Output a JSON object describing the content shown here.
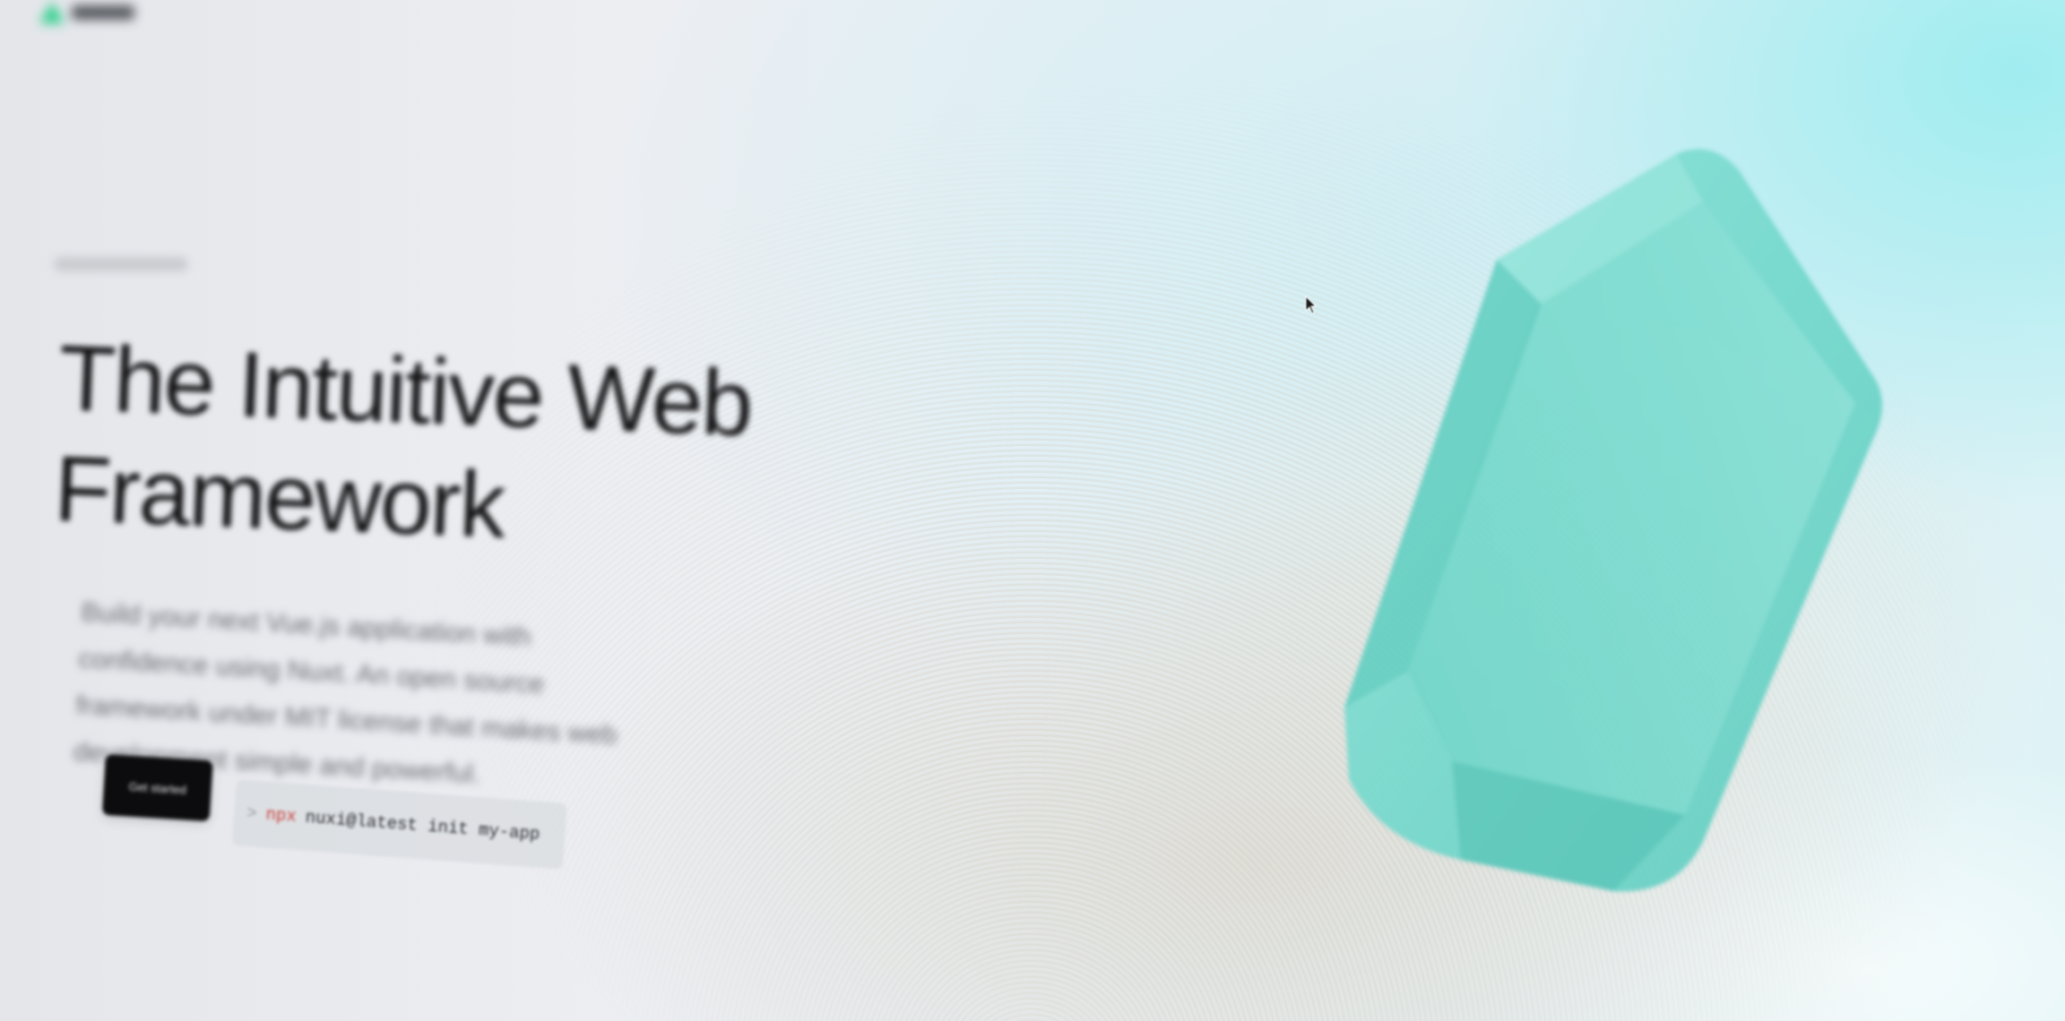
{
  "hero": {
    "headline": "The Intuitive Web\nFramework",
    "description": "Build your next Vue.js application with confidence using Nuxt. An open source framework under MIT license that makes web development simple and powerful.",
    "get_started_label": "Get started",
    "command": {
      "prompt": ">",
      "binary": "npx",
      "args": "nuxi@latest init my-app"
    }
  },
  "colors": {
    "crystal": "#6fd6cb",
    "button_bg": "#0c0c0e",
    "command_binary": "#c9433c"
  },
  "icons": {
    "cursor": "mouse-cursor-icon",
    "logo": "brand-logo-icon"
  }
}
